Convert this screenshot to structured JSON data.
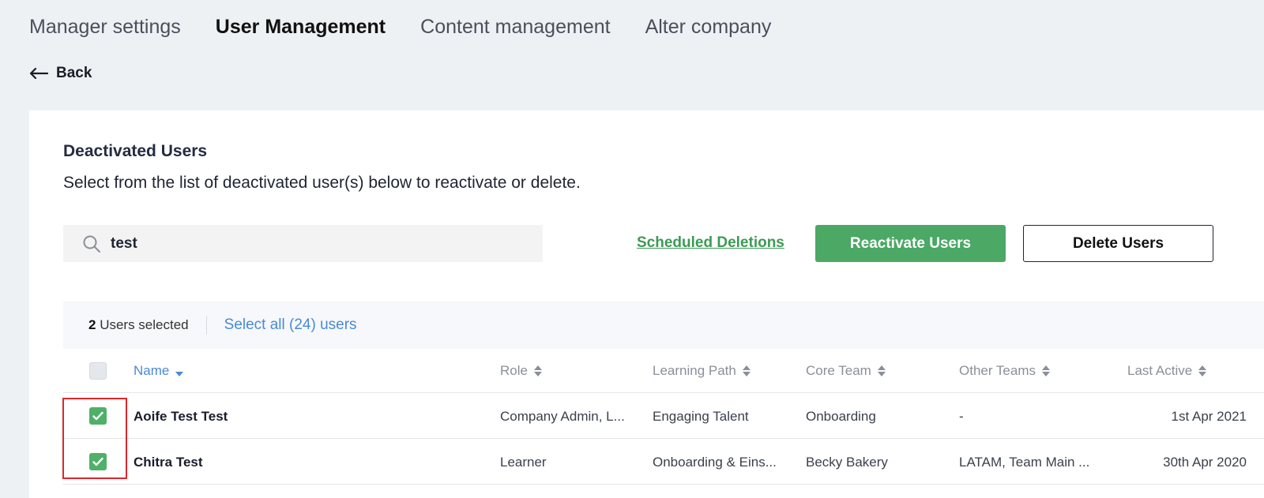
{
  "nav": {
    "tabs": [
      {
        "label": "Manager settings"
      },
      {
        "label": "User Management"
      },
      {
        "label": "Content management"
      },
      {
        "label": "Alter company"
      }
    ]
  },
  "back": {
    "label": "Back"
  },
  "panel": {
    "title": "Deactivated Users",
    "description": "Select from the list of deactivated user(s) below to reactivate or delete."
  },
  "search": {
    "value": "test",
    "icon": "search-icon"
  },
  "actions": {
    "scheduled_deletions": "Scheduled Deletions",
    "reactivate": "Reactivate Users",
    "delete": "Delete Users"
  },
  "selection": {
    "count": "2",
    "count_suffix": " Users selected",
    "select_all": "Select all (24) users"
  },
  "table": {
    "columns": [
      "Name",
      "Role",
      "Learning Path",
      "Core Team",
      "Other Teams",
      "Last Active"
    ],
    "rows": [
      {
        "name": "Aoife Test Test",
        "role": "Company Admin, L...",
        "learning_path": "Engaging Talent",
        "core_team": "Onboarding",
        "other_teams": "-",
        "last_active": "1st Apr 2021",
        "checked": true
      },
      {
        "name": "Chitra Test",
        "role": "Learner",
        "learning_path": "Onboarding & Eins...",
        "core_team": "Becky Bakery",
        "other_teams": "LATAM, Team Main ...",
        "last_active": "30th Apr 2020",
        "checked": true
      }
    ]
  },
  "colors": {
    "accent_green": "#4ba865",
    "link_blue": "#4a8ad4",
    "highlight_red": "#e0262a"
  }
}
